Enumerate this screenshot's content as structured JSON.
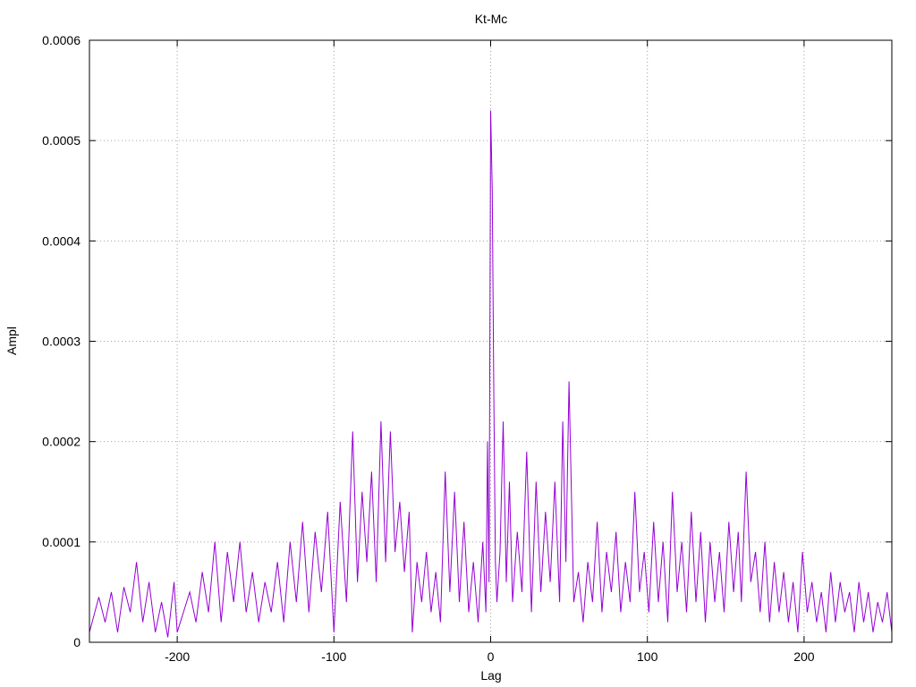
{
  "chart_data": {
    "type": "line",
    "title": "Kt-Mc",
    "xlabel": "Lag",
    "ylabel": "Ampl",
    "xlim": [
      -256,
      256
    ],
    "ylim": [
      0,
      0.0006
    ],
    "xticks": [
      -200,
      -100,
      0,
      100,
      200
    ],
    "xtick_labels": [
      "-200",
      "-100",
      "0",
      "100",
      "200"
    ],
    "yticks": [
      0,
      0.0001,
      0.0002,
      0.0003,
      0.0004,
      0.0005,
      0.0006
    ],
    "ytick_labels": [
      "0",
      "0.0001",
      "0.0002",
      "0.0003",
      "0.0004",
      "0.0005",
      "0.0006"
    ],
    "grid": true,
    "line_color": "#9400d3",
    "series": [
      {
        "x": [
          -256,
          -250,
          -246,
          -242,
          -238,
          -234,
          -230,
          -226,
          -222,
          -218,
          -214,
          -210,
          -206,
          -202,
          -200,
          -196,
          -192,
          -188,
          -184,
          -180,
          -176,
          -172,
          -168,
          -164,
          -160,
          -156,
          -152,
          -148,
          -144,
          -140,
          -136,
          -132,
          -128,
          -124,
          -120,
          -116,
          -112,
          -108,
          -104,
          -100,
          -96,
          -92,
          -88,
          -85,
          -82,
          -79,
          -76,
          -73,
          -70,
          -67,
          -64,
          -61,
          -58,
          -55,
          -52,
          -50,
          -47,
          -44,
          -41,
          -38,
          -35,
          -32,
          -29,
          -26,
          -23,
          -20,
          -17,
          -14,
          -11,
          -8,
          -5,
          -3,
          -2,
          -1,
          0,
          1,
          2,
          3,
          4,
          6,
          8,
          10,
          12,
          14,
          17,
          20,
          23,
          26,
          29,
          32,
          35,
          38,
          41,
          44,
          46,
          48,
          50,
          53,
          56,
          59,
          62,
          65,
          68,
          71,
          74,
          77,
          80,
          83,
          86,
          89,
          92,
          95,
          98,
          101,
          104,
          107,
          110,
          113,
          116,
          119,
          122,
          125,
          128,
          131,
          134,
          137,
          140,
          143,
          146,
          149,
          152,
          155,
          158,
          160,
          163,
          166,
          169,
          172,
          175,
          178,
          181,
          184,
          187,
          190,
          193,
          196,
          199,
          202,
          205,
          208,
          211,
          214,
          217,
          220,
          223,
          226,
          229,
          232,
          235,
          238,
          241,
          244,
          247,
          250,
          253,
          256
        ],
        "y": [
          1e-05,
          4.5e-05,
          2e-05,
          5e-05,
          1e-05,
          5.5e-05,
          3e-05,
          8e-05,
          2e-05,
          6e-05,
          1e-05,
          4e-05,
          5e-06,
          6e-05,
          1e-05,
          3e-05,
          5e-05,
          2e-05,
          7e-05,
          3e-05,
          0.0001,
          2e-05,
          9e-05,
          4e-05,
          0.0001,
          3e-05,
          7e-05,
          2e-05,
          6e-05,
          3e-05,
          8e-05,
          2e-05,
          0.0001,
          4e-05,
          0.00012,
          3e-05,
          0.00011,
          5e-05,
          0.00013,
          1e-05,
          0.00014,
          4e-05,
          0.00021,
          6e-05,
          0.00015,
          8e-05,
          0.00017,
          6e-05,
          0.00022,
          8e-05,
          0.00021,
          9e-05,
          0.00014,
          7e-05,
          0.00013,
          1e-05,
          8e-05,
          4e-05,
          9e-05,
          3e-05,
          7e-05,
          2e-05,
          0.00017,
          5e-05,
          0.00015,
          4e-05,
          0.00012,
          3e-05,
          8e-05,
          2e-05,
          0.0001,
          3e-05,
          0.0002,
          6e-05,
          0.00053,
          0.00045,
          0.00025,
          8e-05,
          4e-05,
          9e-05,
          0.00022,
          6e-05,
          0.00016,
          4e-05,
          0.00011,
          5e-05,
          0.00019,
          3e-05,
          0.00016,
          5e-05,
          0.00013,
          6e-05,
          0.00016,
          4e-05,
          0.00022,
          8e-05,
          0.00026,
          4e-05,
          7e-05,
          2e-05,
          8e-05,
          4e-05,
          0.00012,
          3e-05,
          9e-05,
          5e-05,
          0.00011,
          3e-05,
          8e-05,
          4e-05,
          0.00015,
          5e-05,
          9e-05,
          3e-05,
          0.00012,
          4e-05,
          0.0001,
          2e-05,
          0.00015,
          5e-05,
          0.0001,
          3e-05,
          0.00013,
          4e-05,
          0.00011,
          2e-05,
          0.0001,
          4e-05,
          9e-05,
          3e-05,
          0.00012,
          5e-05,
          0.00011,
          4e-05,
          0.00017,
          6e-05,
          9e-05,
          3e-05,
          0.0001,
          2e-05,
          8e-05,
          3e-05,
          7e-05,
          2e-05,
          6e-05,
          1e-05,
          9e-05,
          3e-05,
          6e-05,
          2e-05,
          5e-05,
          1e-05,
          7e-05,
          2e-05,
          6e-05,
          3e-05,
          5e-05,
          1e-05,
          6e-05,
          2e-05,
          5e-05,
          1e-05,
          4e-05,
          2e-05,
          5e-05,
          1e-05
        ]
      }
    ]
  }
}
